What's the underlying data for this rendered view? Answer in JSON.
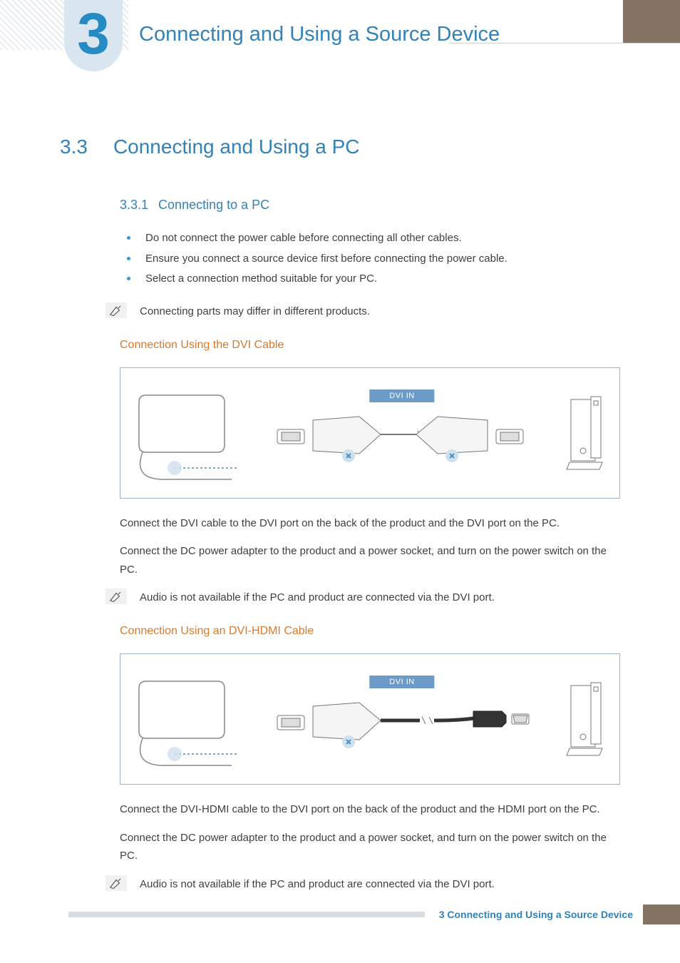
{
  "chapter": {
    "number": "3",
    "title": "Connecting and Using a Source Device"
  },
  "section": {
    "number": "3.3",
    "title": "Connecting and Using a PC"
  },
  "subsection": {
    "number": "3.3.1",
    "title": "Connecting to a PC"
  },
  "bullets": [
    "Do not connect the power cable before connecting all other cables.",
    "Ensure you connect a source device first before connecting the power cable.",
    "Select a connection method suitable for your PC."
  ],
  "note1": "Connecting parts may differ in different products.",
  "dvi": {
    "heading": "Connection Using the DVI Cable",
    "port_label": "DVI IN",
    "p1": "Connect the DVI cable to the DVI port on the back of the product and the DVI port on the PC.",
    "p2": "Connect the DC power adapter to the product and a power socket, and turn on the power switch on the PC.",
    "note": "Audio is not available if the PC and product are connected via the DVI port."
  },
  "dvihdmi": {
    "heading": "Connection Using an DVI-HDMI Cable",
    "port_label": "DVI IN",
    "p1": "Connect the DVI-HDMI cable to the DVI port on the back of the product and the HDMI port on the PC.",
    "p2": "Connect the DC power adapter to the product and a power socket, and turn on the power switch on the PC.",
    "note": "Audio is not available if the PC and product are connected via the DVI port."
  },
  "footer": {
    "chapter_label": "3 Connecting and Using a Source Device",
    "page": ""
  }
}
